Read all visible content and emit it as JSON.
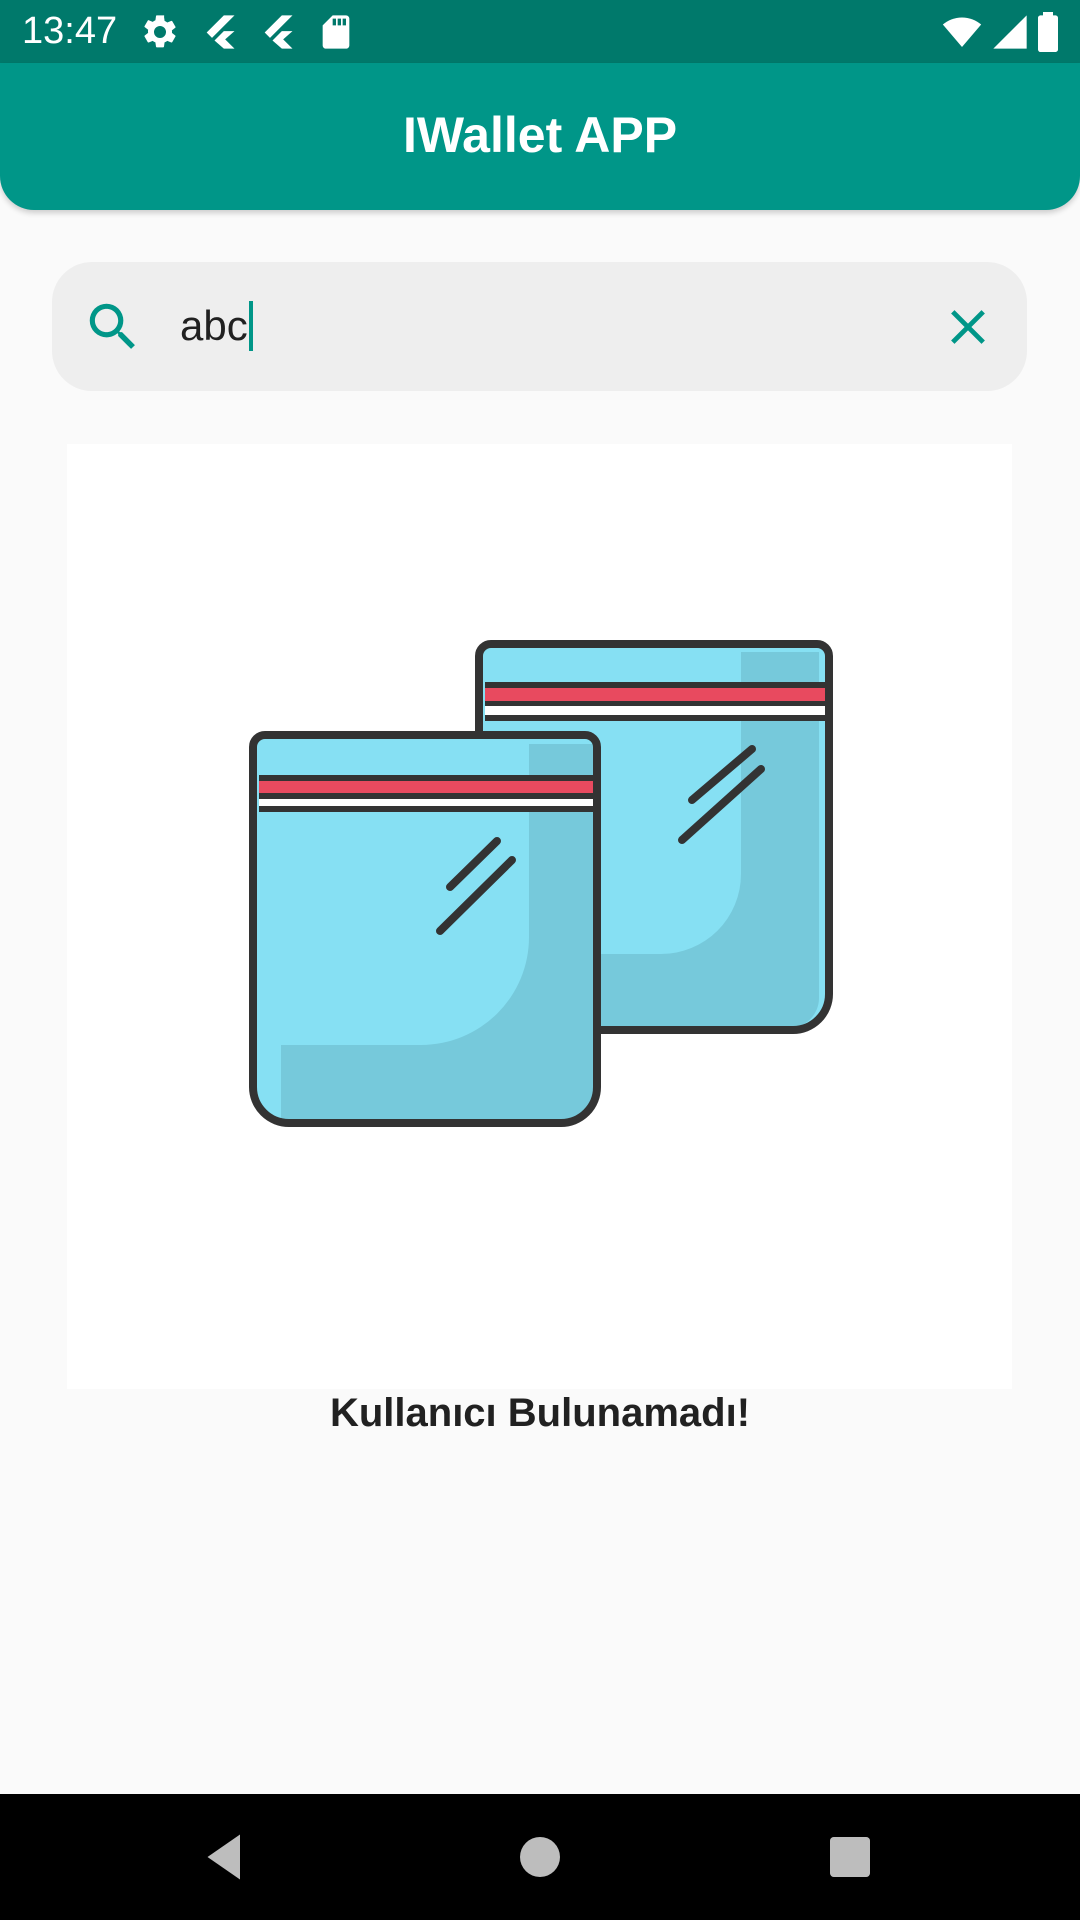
{
  "status_bar": {
    "time": "13:47",
    "left_icons": [
      "settings-icon",
      "flutter-icon",
      "flutter-icon",
      "sd-card-icon"
    ],
    "right_icons": [
      "wifi-icon",
      "signal-icon",
      "battery-icon"
    ]
  },
  "app_bar": {
    "title": "IWallet APP"
  },
  "search": {
    "value": "abc",
    "icon": "search-icon",
    "clear_icon": "close-icon"
  },
  "empty_state": {
    "illustration": "empty-bags-illustration",
    "message": "Kullanıcı Bulunamadı!"
  },
  "nav_bar": {
    "buttons": [
      "back-icon",
      "home-icon",
      "recents-icon"
    ]
  },
  "colors": {
    "primary": "#009688",
    "primary_dark": "#00796B",
    "background": "#FAFAFA",
    "search_bg": "#EEEEEE",
    "bag_light": "#86E0F3",
    "bag_shade": "#76C9DB",
    "bag_outline": "#333333",
    "zip_red": "#E84A5F"
  }
}
